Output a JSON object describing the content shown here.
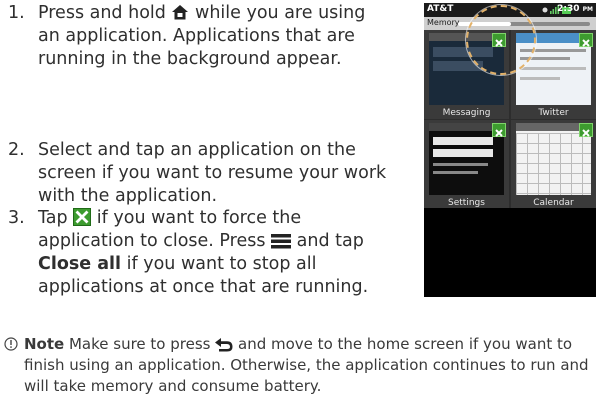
{
  "steps": [
    {
      "num": "1.",
      "line1": "Press and hold",
      "icon": "home-icon",
      "line1b": "while you are using an application. Applications that are running in the background appear."
    },
    {
      "num": "2.",
      "text": "Select and tap an application on the screen if you want to resume your work with the application."
    },
    {
      "num": "3.",
      "t1": "Tap",
      "close_icon": "close-x-icon",
      "t2": "if you want to force the application to close. Press",
      "menu_icon": "menu-icon",
      "t3": "and tap",
      "bold": "Close all",
      "t4": "if you want to stop all applications at once that are running."
    }
  ],
  "note": {
    "label": "Note",
    "t1": "Make sure to press",
    "back_icon": "back-icon",
    "t2": "and move to the home screen if you want to finish using an application. Otherwise, the application continues to run and will take memory and consume battery."
  },
  "phone": {
    "carrier": "AT&T",
    "time": "2:30",
    "ampm": "PM",
    "memory_label": "Memory",
    "memory_used_fraction": 0.4,
    "apps": [
      {
        "label": "Messaging"
      },
      {
        "label": "Twitter"
      },
      {
        "label": "Settings"
      },
      {
        "label": "Calendar"
      }
    ]
  },
  "colors": {
    "accent_green": "#3d9b2f",
    "callout": "#e3b26a"
  }
}
